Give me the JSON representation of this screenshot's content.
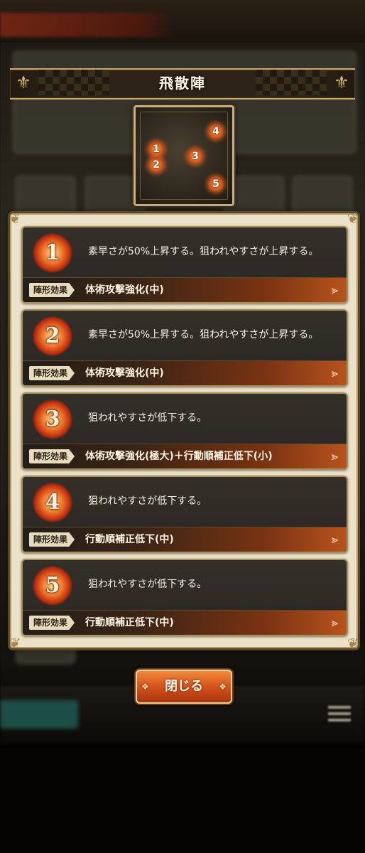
{
  "formation": {
    "title": "飛散陣",
    "positions": [
      "1",
      "2",
      "3",
      "4",
      "5"
    ]
  },
  "slots": [
    {
      "number": "1",
      "description": "素早さが50%上昇する。狙われやすさが上昇する。",
      "tag": "陣形効果",
      "effect": "体術攻撃強化(中)"
    },
    {
      "number": "2",
      "description": "素早さが50%上昇する。狙われやすさが上昇する。",
      "tag": "陣形効果",
      "effect": "体術攻撃強化(中)"
    },
    {
      "number": "3",
      "description": "狙われやすさが低下する。",
      "tag": "陣形効果",
      "effect": "体術攻撃強化(極大)＋行動順補正低下(小)"
    },
    {
      "number": "4",
      "description": "狙われやすさが低下する。",
      "tag": "陣形効果",
      "effect": "行動順補正低下(中)"
    },
    {
      "number": "5",
      "description": "狙われやすさが低下する。",
      "tag": "陣形効果",
      "effect": "行動順補正低下(中)"
    }
  ],
  "close_button": {
    "label": "閉じる"
  },
  "icons": {
    "badge": "sunburst-badge-icon",
    "arrow": "chevron-right-icon",
    "corner": "ornament-icon"
  },
  "colors": {
    "accent": "#d4531c",
    "parchment": "#ebe2c9",
    "card": "#2d2a24",
    "gold": "#c9aa6b"
  }
}
